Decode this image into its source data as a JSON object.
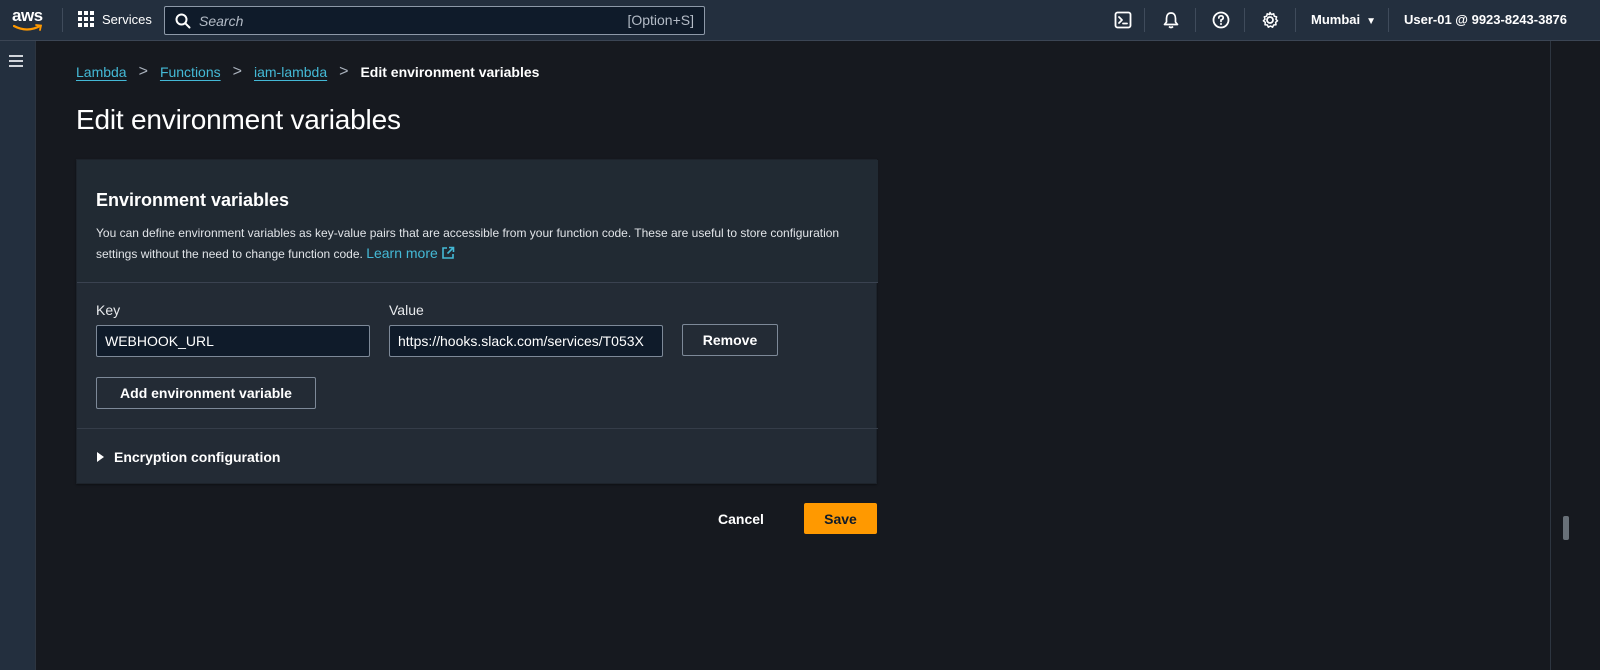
{
  "nav": {
    "logo_text": "aws",
    "services_label": "Services",
    "search_placeholder": "Search",
    "search_shortcut": "[Option+S]",
    "region": "Mumbai",
    "account": "User-01 @ 9923-8243-3876"
  },
  "breadcrumb": {
    "items": [
      "Lambda",
      "Functions",
      "iam-lambda"
    ],
    "current": "Edit environment variables"
  },
  "page": {
    "title": "Edit environment variables"
  },
  "panel": {
    "title": "Environment variables",
    "description": "You can define environment variables as key-value pairs that are accessible from your function code. These are useful to store configuration settings without the need to change function code.",
    "learn_more": "Learn more",
    "key_label": "Key",
    "value_label": "Value",
    "variables": [
      {
        "key": "WEBHOOK_URL",
        "value": "https://hooks.slack.com/services/T053X"
      }
    ],
    "remove_label": "Remove",
    "add_label": "Add environment variable",
    "encryption_label": "Encryption configuration"
  },
  "actions": {
    "cancel_label": "Cancel",
    "save_label": "Save"
  },
  "colors": {
    "accent": "#ff9900",
    "link": "#44b9d6",
    "nav_bg": "#232f3e",
    "page_bg": "#16191f"
  }
}
